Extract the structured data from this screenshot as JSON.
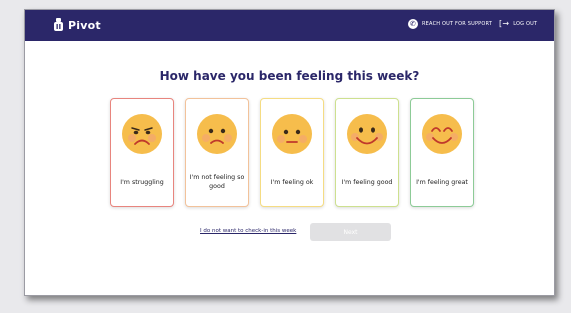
{
  "header": {
    "brand": "Pivot",
    "support_label": "REACH OUT FOR SUPPORT",
    "logout_label": "LOG OUT"
  },
  "question": "How have you been feeling this week?",
  "moods": [
    {
      "label": "I'm struggling",
      "icon": "sad-face-icon"
    },
    {
      "label": "I'm not feeling so good",
      "icon": "frown-face-icon"
    },
    {
      "label": "I'm feeling ok",
      "icon": "neutral-face-icon"
    },
    {
      "label": "I'm feeling good",
      "icon": "smile-face-icon"
    },
    {
      "label": "I'm feeling great",
      "icon": "grin-face-icon"
    }
  ],
  "skip_link": "I do not want to check-in this week",
  "next_label": "Next",
  "colors": {
    "brand": "#2b2769",
    "face": "#f6bd4c",
    "card_borders": [
      "#e8857e",
      "#f2c29a",
      "#f5dc83",
      "#cde08f",
      "#8dcb97"
    ]
  }
}
